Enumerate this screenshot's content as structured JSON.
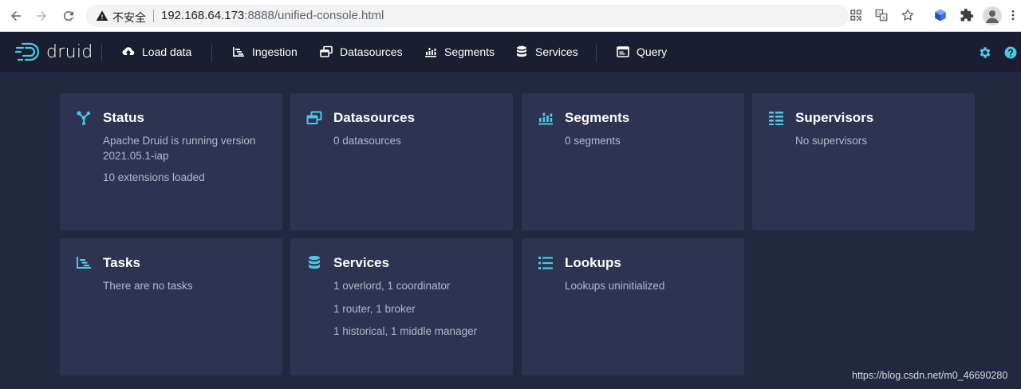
{
  "browser": {
    "security_label": "不安全",
    "url_host": "192.168.64.173",
    "url_rest": ":8888/unified-console.html"
  },
  "header": {
    "logo_text": "druid",
    "nav": [
      {
        "label": "Load data",
        "icon": "cloud-upload-icon"
      },
      {
        "label": "Ingestion",
        "icon": "gantt-chart-icon"
      },
      {
        "label": "Datasources",
        "icon": "multi-select-icon"
      },
      {
        "label": "Segments",
        "icon": "stacked-chart-icon"
      },
      {
        "label": "Services",
        "icon": "database-icon"
      },
      {
        "label": "Query",
        "icon": "application-icon"
      }
    ],
    "accent_color": "#48cae4"
  },
  "cards": [
    {
      "title": "Status",
      "icon": "graph-icon",
      "lines": [
        "Apache Druid is running version 2021.05.1-iap",
        "10 extensions loaded"
      ]
    },
    {
      "title": "Datasources",
      "icon": "multi-select-icon",
      "lines": [
        "0 datasources"
      ]
    },
    {
      "title": "Segments",
      "icon": "stacked-chart-icon",
      "lines": [
        "0 segments"
      ]
    },
    {
      "title": "Supervisors",
      "icon": "list-columns-icon",
      "lines": [
        "No supervisors"
      ]
    },
    {
      "title": "Tasks",
      "icon": "gantt-chart-icon",
      "lines": [
        "There are no tasks"
      ]
    },
    {
      "title": "Services",
      "icon": "database-icon",
      "lines": [
        "1 overlord, 1 coordinator",
        "1 router, 1 broker",
        "1 historical, 1 middle manager"
      ]
    },
    {
      "title": "Lookups",
      "icon": "properties-icon",
      "lines": [
        "Lookups uninitialized"
      ]
    }
  ],
  "watermark": "https://blog.csdn.net/m0_46690280"
}
